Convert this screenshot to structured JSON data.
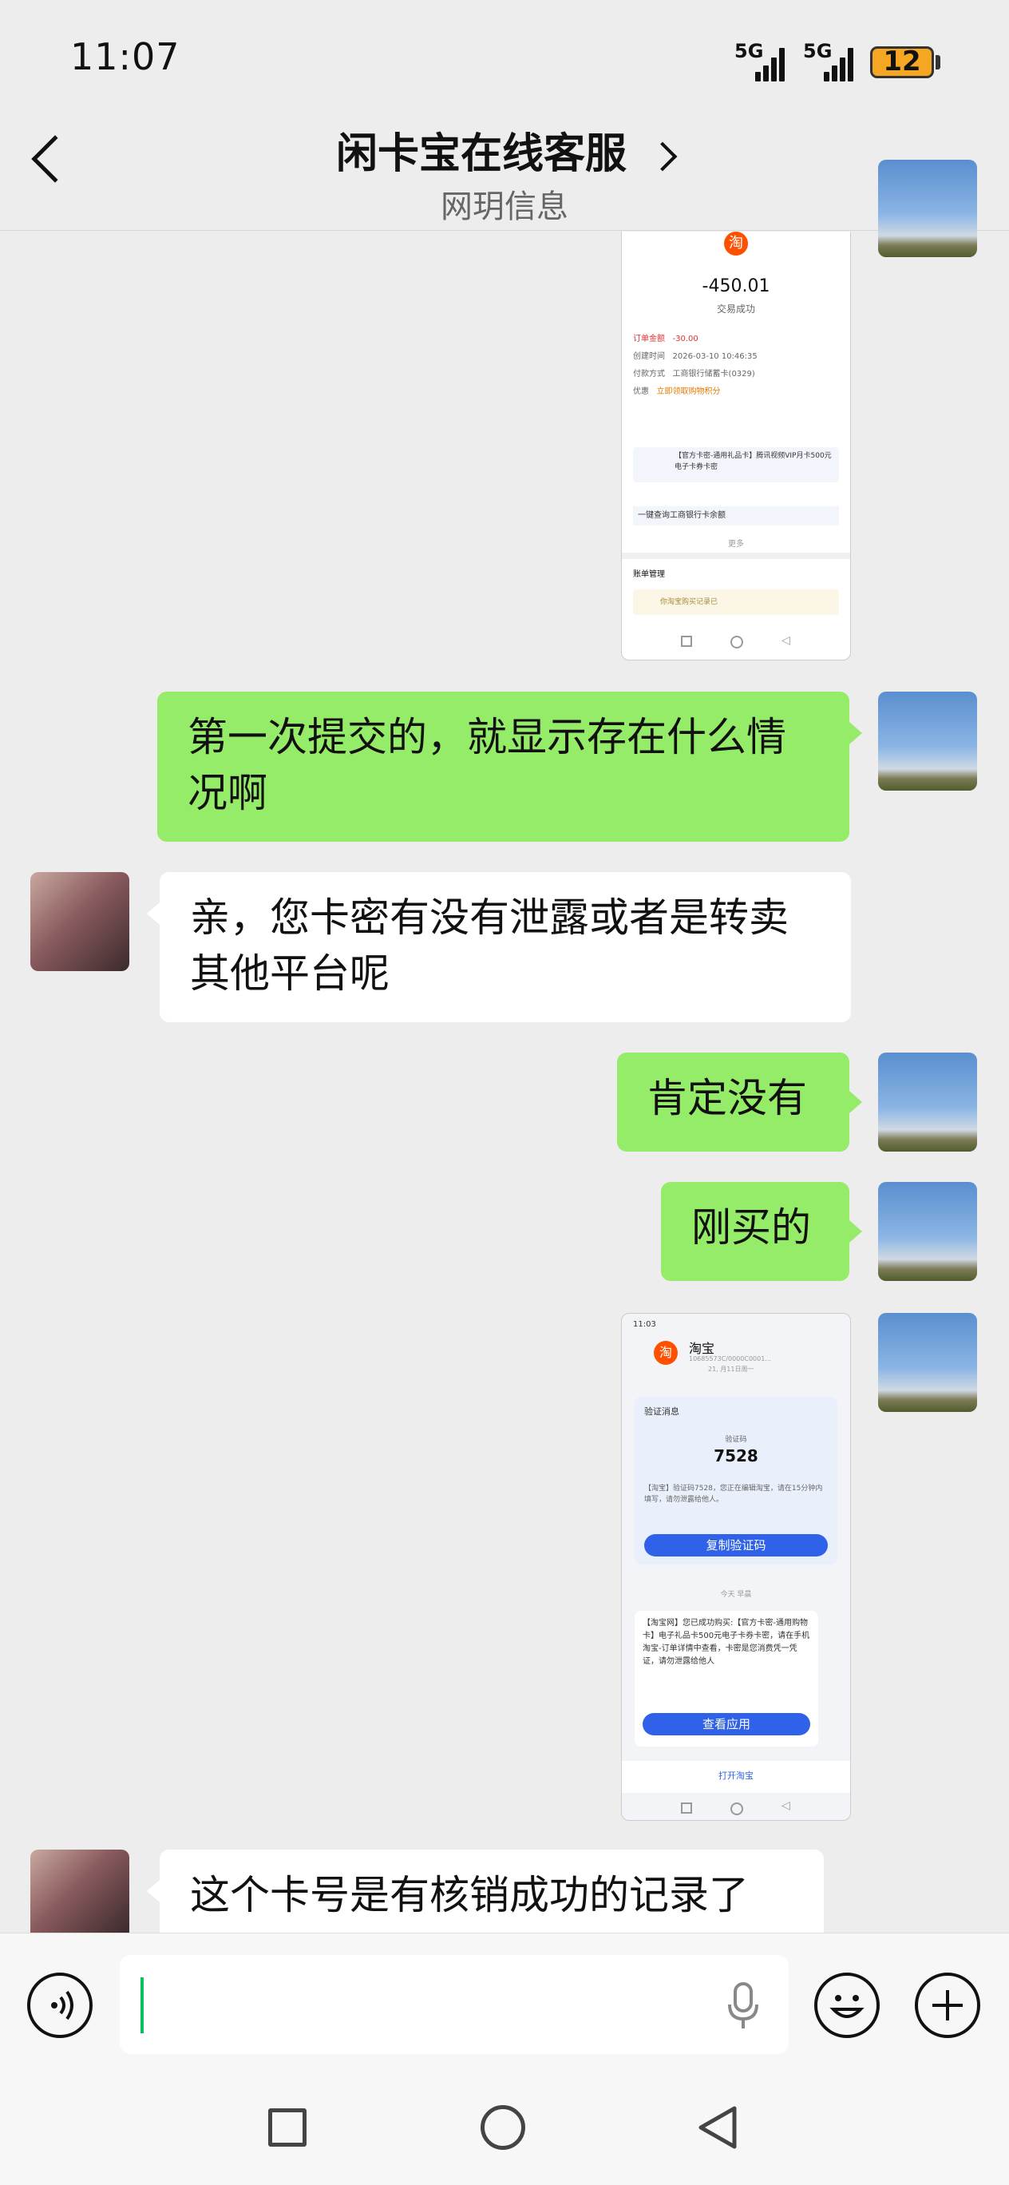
{
  "status_bar": {
    "time": "11:07",
    "signal_1": "5G",
    "signal_2": "5G",
    "battery": "12"
  },
  "header": {
    "title": "闲卡宝在线客服",
    "subtitle": "网玥信息"
  },
  "screenshot_1": {
    "amount": "-450.01",
    "status": "交易成功",
    "rows": [
      {
        "label": "订单金额",
        "value": "-30.00"
      },
      {
        "label": "创建时间",
        "value": "2026-03-10 10:46:35"
      },
      {
        "label": "付款方式",
        "value": "工商银行储蓄卡(0329)"
      },
      {
        "label": "优惠",
        "value": "立即领取购物积分"
      }
    ],
    "product": "【官方卡密-通用礼品卡】腾讯视频VIP月卡500元电子卡券卡密",
    "bank_row": "一键查询工商银行卡余额",
    "more": "更多",
    "bill_section": "账单管理",
    "bill_tip": "你淘宝购买记录已"
  },
  "screenshot_2": {
    "time": "11:03",
    "sender": "淘宝",
    "sender_sub": "10685573C/0000C0001...",
    "sender_date": "21, 月11日周一",
    "verify_title": "验证消息",
    "code_label": "验证码",
    "code": "7528",
    "verify_text": "【淘宝】验证码7528，您正在编辑淘宝，请在15分钟内填写，请勿泄露给他人。",
    "copy_button": "复制验证码",
    "today": "今天 早晨",
    "order_text": "【淘宝网】您已成功购买:【官方卡密-通用购物卡】电子礼品卡500元电子卡券卡密，请在手机淘宝-订单详情中查看，卡密是您消费凭一凭证，请勿泄露给他人",
    "view_button": "查看应用",
    "open_taobao": "打开淘宝"
  },
  "messages": [
    {
      "side": "me",
      "text_1": "第一次提交的，就显示存在什么情",
      "text_2": "况啊"
    },
    {
      "side": "them",
      "text_1": "亲，您卡密有没有泄露或者是转卖",
      "text_2": "其他平台呢"
    },
    {
      "side": "me",
      "text_1": "肯定没有"
    },
    {
      "side": "me",
      "text_1": "刚买的"
    },
    {
      "side": "them",
      "text_1": "这个卡号是有核销成功的记录了"
    }
  ]
}
